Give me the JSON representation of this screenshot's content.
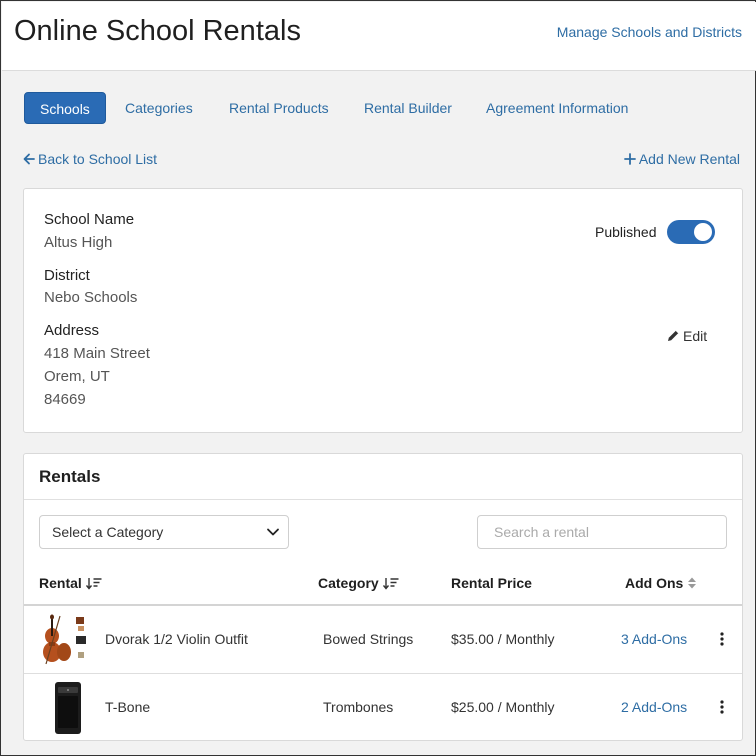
{
  "header": {
    "title": "Online School Rentals",
    "manage_link": "Manage Schools and Districts"
  },
  "tabs": [
    {
      "label": "Schools",
      "active": true
    },
    {
      "label": "Categories",
      "active": false
    },
    {
      "label": "Rental Products",
      "active": false
    },
    {
      "label": "Rental Builder",
      "active": false
    },
    {
      "label": "Agreement Information",
      "active": false
    }
  ],
  "nav": {
    "back_label": "Back to School List",
    "add_label": "Add New Rental"
  },
  "school": {
    "name_label": "School Name",
    "name": "Altus High",
    "district_label": "District",
    "district": "Nebo Schools",
    "address_label": "Address",
    "address_line1": "418 Main Street",
    "address_line2": "Orem, UT",
    "address_line3": "84669",
    "published_label": "Published",
    "published": true,
    "edit_label": "Edit"
  },
  "rentals": {
    "title": "Rentals",
    "category_select": "Select a Category",
    "search_placeholder": "Search a rental",
    "columns": {
      "rental": "Rental",
      "category": "Category",
      "price": "Rental Price",
      "addons": "Add Ons"
    },
    "rows": [
      {
        "name": "Dvorak 1/2 Violin Outfit",
        "category": "Bowed Strings",
        "price": "$35.00 / Monthly",
        "addons": "3 Add-Ons",
        "thumb": "violin-image"
      },
      {
        "name": "T-Bone",
        "category": "Trombones",
        "price": "$25.00 / Monthly",
        "addons": "2 Add-Ons",
        "thumb": "tbone-device-image"
      }
    ]
  },
  "colors": {
    "accent": "#2a6bb5",
    "link": "#2e6da4"
  }
}
